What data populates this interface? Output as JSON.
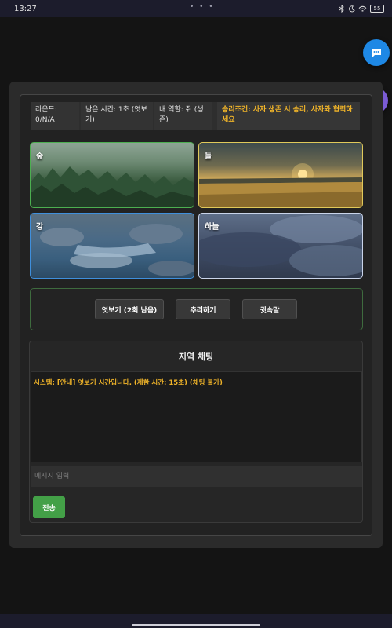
{
  "status_bar": {
    "time": "13:27",
    "dots": "• • •",
    "icons": [
      "bluetooth-icon",
      "moon-icon",
      "wifi-icon",
      "battery-icon"
    ],
    "battery": "55"
  },
  "info": {
    "round": "라운드: 0/N/A",
    "time_left": "남은 시간: 1초 (엿보기)",
    "my_role": "내 역할: 쥐 (생존)",
    "win_condition": "승리조건: 사자 생존 시 승리, 사자와 협력하세요"
  },
  "areas": [
    {
      "label": "숲",
      "color": "#4caf50"
    },
    {
      "label": "들",
      "color": "#e0c95a"
    },
    {
      "label": "강",
      "color": "#3f8fdc"
    },
    {
      "label": "하늘",
      "color": "#c9d4ea"
    }
  ],
  "actions": {
    "peek": "엿보기 (2회 남음)",
    "guess": "추리하기",
    "whisper": "귓속말"
  },
  "chat": {
    "title": "지역 채팅",
    "messages": [
      "시스템: [안내] 엿보기 시간입니다. (제한 시간: 15초) (채팅 불가)"
    ],
    "input_placeholder": "메시지 입력",
    "send_label": "전송"
  },
  "colors": {
    "accent_chat": "#1e88e5",
    "accent_help": "#7b5cd6",
    "warning_text": "#f0b429",
    "send_button": "#43a047"
  }
}
